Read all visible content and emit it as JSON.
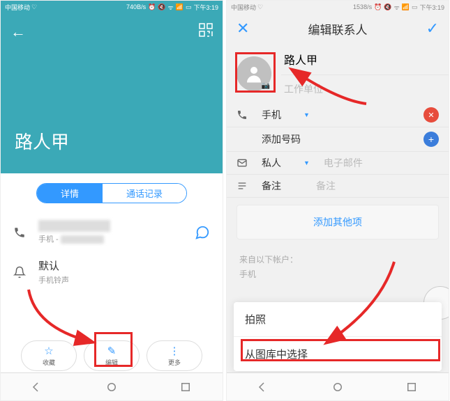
{
  "left": {
    "statusbar": {
      "carrier": "中国移动",
      "speed": "740B/s",
      "time": "下午3:19"
    },
    "contactName": "路人甲",
    "tabs": {
      "details": "详情",
      "callLog": "通话记录"
    },
    "phone": {
      "label": "手机"
    },
    "ringtone": {
      "title": "默认",
      "sub": "手机铃声"
    },
    "actions": {
      "favorite": "收藏",
      "edit": "编辑",
      "more": "更多"
    }
  },
  "right": {
    "statusbar": {
      "carrier": "中国移动",
      "speed": "1538/s",
      "time": "下午3:19"
    },
    "title": "编辑联系人",
    "nameValue": "路人甲",
    "companyPlaceholder": "工作单位",
    "phoneLabel": "手机",
    "addNumber": "添加号码",
    "emailLabel": "私人",
    "emailPlaceholder": "电子邮件",
    "notesLabel": "备注",
    "notesPlaceholder": "备注",
    "addOthers": "添加其他项",
    "accountsTitle": "来自以下帐户：",
    "accountsValue": "手机",
    "sheet": {
      "takePhoto": "拍照",
      "fromGallery": "从图库中选择"
    }
  }
}
